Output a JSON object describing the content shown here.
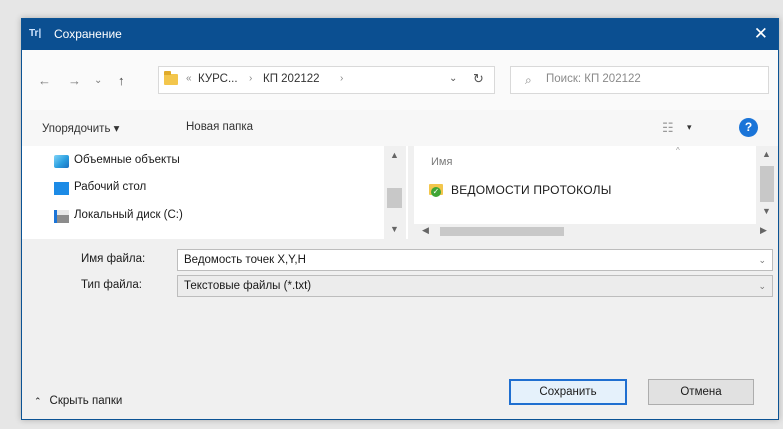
{
  "window": {
    "title": "Сохранение",
    "app_icon_text": "Tr|"
  },
  "nav": {
    "back": "←",
    "forward": "→",
    "recent": "⌄",
    "up": "↑",
    "breadcrumb_prefix": "«",
    "breadcrumbs": [
      "КУРС...",
      "КП 202122"
    ],
    "crumb_sep": "›",
    "refresh": "↻",
    "dropdown": "⌄",
    "search_placeholder": "Поиск: КП 202122"
  },
  "toolbar": {
    "organize_label": "Упорядочить ▾",
    "new_folder_label": "Новая папка",
    "view_glyph": "☷",
    "view_dropdown": "▾",
    "help_label": "?"
  },
  "sidebar": {
    "items": [
      {
        "label": "Объемные объекты",
        "icon": "3d-objects-icon"
      },
      {
        "label": "Рабочий стол",
        "icon": "desktop-icon"
      },
      {
        "label": "Локальный диск (C:)",
        "icon": "drive-icon"
      }
    ]
  },
  "file_list": {
    "column_name": "Имя",
    "items": [
      {
        "label": "ВЕДОМОСТИ ПРОТОКОЛЫ",
        "icon": "folder-synced-icon"
      }
    ]
  },
  "form": {
    "filename_label": "Имя файла:",
    "filename_value": "Ведомость точек X,Y,H",
    "filetype_label": "Тип файла:",
    "filetype_value": "Текстовые файлы (*.txt)"
  },
  "footer": {
    "hide_folders_label": "Скрыть папки",
    "save_label": "Сохранить",
    "cancel_label": "Отмена"
  },
  "colors": {
    "titlebar": "#0b4f91",
    "accent": "#1f6fd0"
  }
}
